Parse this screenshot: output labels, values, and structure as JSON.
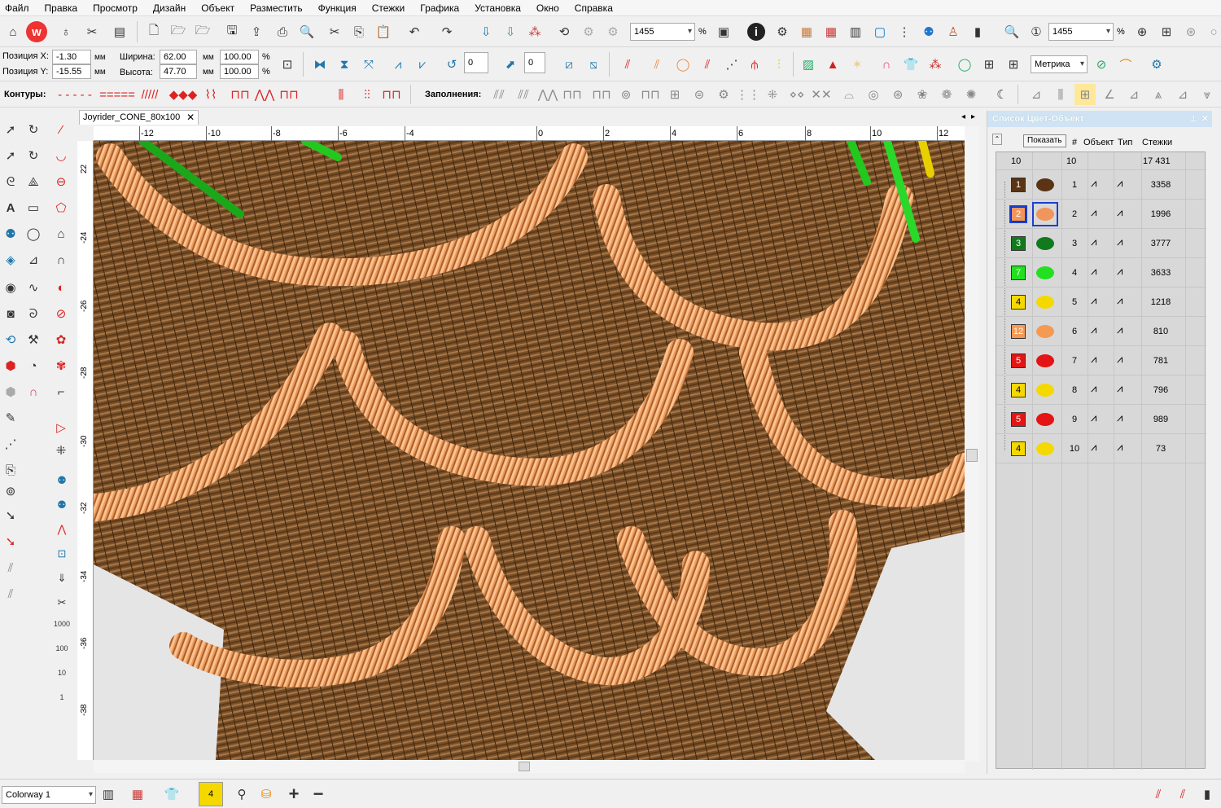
{
  "menu": [
    "Файл",
    "Правка",
    "Просмотр",
    "Дизайн",
    "Объект",
    "Разместить",
    "Функция",
    "Стежки",
    "Графика",
    "Установка",
    "Окно",
    "Справка"
  ],
  "toolbar1": {
    "zoom_left": "1455",
    "zoom_right": "1455",
    "percent": "%"
  },
  "toolbar2": {
    "pos_x_label": "Позиция X:",
    "pos_x": "-1.30",
    "pos_y_label": "Позиция Y:",
    "pos_y": "-15.55",
    "width_label": "Ширина:",
    "width": "62.00",
    "height_label": "Высота:",
    "height": "47.70",
    "scale_w": "100.00",
    "scale_h": "100.00",
    "unit": "мм",
    "percent": "%",
    "rotate_val": "0",
    "slant_val": "0",
    "units_combo": "Метрика"
  },
  "toolbar3": {
    "contours_label": "Контуры:",
    "fills_label": "Заполнения:"
  },
  "document": {
    "tab_title": "Joyrider_CONE_80x100",
    "close": "✕"
  },
  "ruler": {
    "h_ticks": [
      "-12",
      "-10",
      "-8",
      "-6",
      "-4",
      "0",
      "2",
      "4",
      "6",
      "8",
      "10",
      "12"
    ],
    "v_ticks": [
      "22",
      "-24",
      "-26",
      "-28",
      "-30",
      "-32",
      "-34",
      "-36",
      "-38"
    ]
  },
  "panel": {
    "title": "Список Цвет-Объект",
    "show_button": "Показать",
    "headers": {
      "num": "#",
      "object": "Объект",
      "type": "Тип",
      "stitches": "Стежки"
    },
    "summary": {
      "colors": "10",
      "objects": "10",
      "stitches": "17 431"
    },
    "rows": [
      {
        "color": "1",
        "hex": "#5a3414",
        "num": "1",
        "stitches": "3358"
      },
      {
        "color": "2",
        "hex": "#f0965c",
        "num": "2",
        "stitches": "1996"
      },
      {
        "color": "3",
        "hex": "#127a1c",
        "num": "3",
        "stitches": "3777"
      },
      {
        "color": "7",
        "hex": "#22e020",
        "num": "4",
        "stitches": "3633"
      },
      {
        "color": "4",
        "hex": "#f4d800",
        "num": "5",
        "stitches": "1218"
      },
      {
        "color": "12",
        "hex": "#f49a54",
        "num": "6",
        "stitches": "810"
      },
      {
        "color": "5",
        "hex": "#e41414",
        "num": "7",
        "stitches": "781"
      },
      {
        "color": "4",
        "hex": "#f4d800",
        "num": "8",
        "stitches": "796"
      },
      {
        "color": "5",
        "hex": "#e41414",
        "num": "9",
        "stitches": "989"
      },
      {
        "color": "4",
        "hex": "#f4d800",
        "num": "10",
        "stitches": "73"
      }
    ]
  },
  "status": {
    "colorway": "Colorway 1",
    "current_color": "4"
  },
  "colors": {
    "thread_dark": "#4a2d12",
    "thread_mid": "#8a5a2e",
    "thread_light": "#f4b27a",
    "accent_green": "#22c81e",
    "panel_title_bg": "#cfe3f5"
  },
  "icons": [
    "home-icon",
    "wilcom-logo-icon",
    "new-icon",
    "open-icon",
    "save-icon",
    "cut-icon",
    "copy-icon",
    "paste-icon",
    "undo-icon",
    "redo-icon",
    "info-icon",
    "zoom-icon",
    "select-icon",
    "close-icon"
  ]
}
